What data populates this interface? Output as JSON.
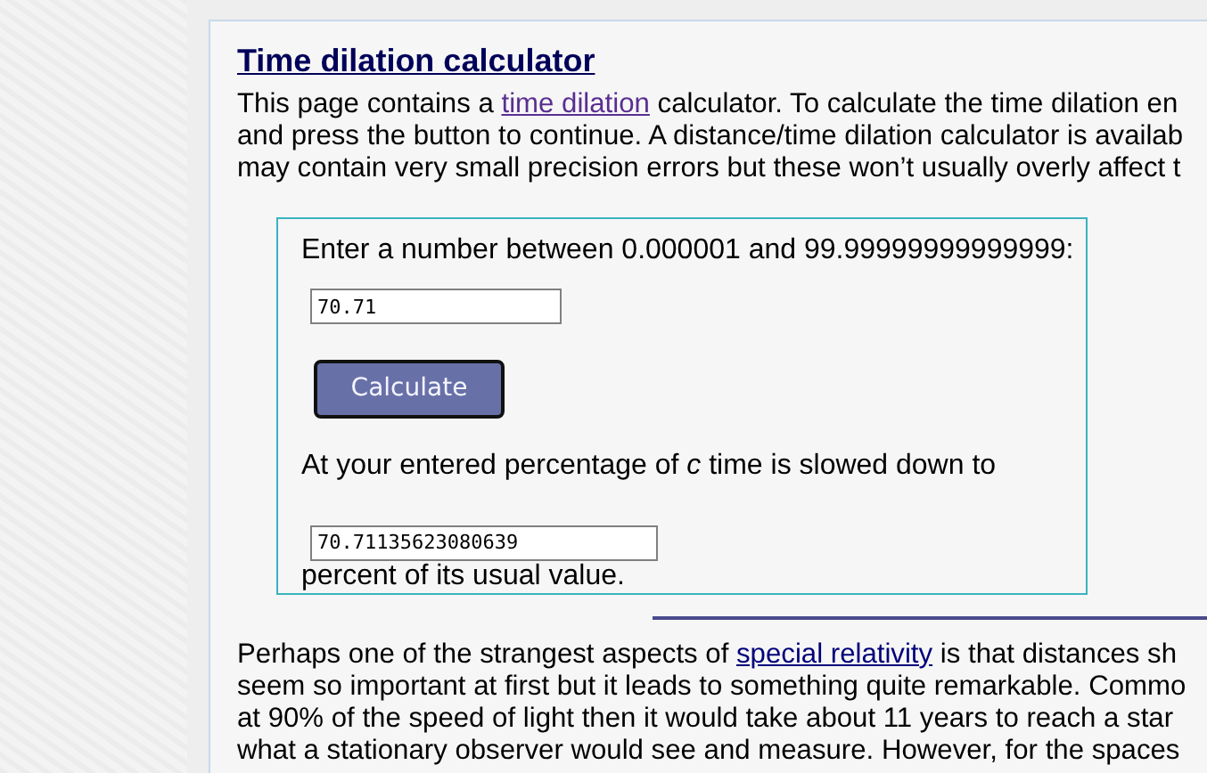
{
  "title": "Time dilation calculator",
  "intro": [
    [
      {
        "kind": "text",
        "text": "This page contains a "
      },
      {
        "kind": "link",
        "text": "time dilation",
        "visited": true
      },
      {
        "kind": "text",
        "text": " calculator. To calculate the time dilation en"
      }
    ],
    [
      {
        "kind": "text",
        "text": "and press the button to continue. A distance/time dilation calculator is availab"
      }
    ],
    [
      {
        "kind": "text",
        "text": "may contain very small precision errors but these won’t usually overly affect t"
      }
    ]
  ],
  "calculator": {
    "prompt": "Enter a number between 0.000001 and 99.99999999999999:",
    "input_value": "70.71",
    "button": "Calculate",
    "result_before": "At your entered percentage of ",
    "result_symbol": "c",
    "result_after": " time is slowed down to",
    "output_value": "70.71135623080639",
    "result_suffix": "percent of its usual value."
  },
  "body": [
    [
      {
        "kind": "text",
        "text": "Perhaps one of the strangest aspects of "
      },
      {
        "kind": "link",
        "text": "special relativity",
        "visited": false
      },
      {
        "kind": "text",
        "text": " is that distances sh"
      }
    ],
    [
      {
        "kind": "text",
        "text": "seem so important at first but it leads to something quite remarkable. Commo"
      }
    ],
    [
      {
        "kind": "text",
        "text": "at 90% of the speed of light then it would take about 11 years to reach a star"
      }
    ],
    [
      {
        "kind": "text",
        "text": "what a stationary observer would see and measure. However, for the spaces"
      }
    ]
  ]
}
